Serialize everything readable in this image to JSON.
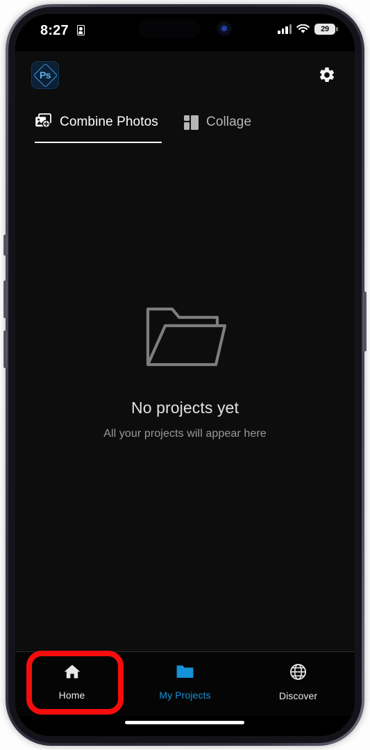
{
  "status_bar": {
    "time": "8:27",
    "lock_icon": "lock-portrait-icon",
    "signal_icon": "cellular-signal-icon",
    "wifi_icon": "wifi-icon",
    "battery_percent": "29"
  },
  "header": {
    "app_logo": "photoshop-express-logo",
    "app_logo_text": "Ps",
    "settings_icon": "gear-icon"
  },
  "tabs": [
    {
      "label": "Combine Photos",
      "icon": "combine-photos-icon",
      "active": true
    },
    {
      "label": "Collage",
      "icon": "collage-grid-icon",
      "active": false
    }
  ],
  "empty_state": {
    "icon": "folder-outline-icon",
    "title": "No projects yet",
    "subtitle": "All your projects will appear here"
  },
  "bottom_nav": [
    {
      "label": "Home",
      "icon": "home-icon",
      "active": false,
      "highlighted": true
    },
    {
      "label": "My Projects",
      "icon": "folder-filled-icon",
      "active": true,
      "highlighted": false
    },
    {
      "label": "Discover",
      "icon": "globe-icon",
      "active": false,
      "highlighted": false
    }
  ],
  "annotation": {
    "target": "Home",
    "color": "#f50d0d"
  },
  "colors": {
    "accent_blue": "#1493d8",
    "app_background": "#0d0d0d",
    "nav_background": "#050505",
    "annotation_red": "#f50d0d"
  }
}
